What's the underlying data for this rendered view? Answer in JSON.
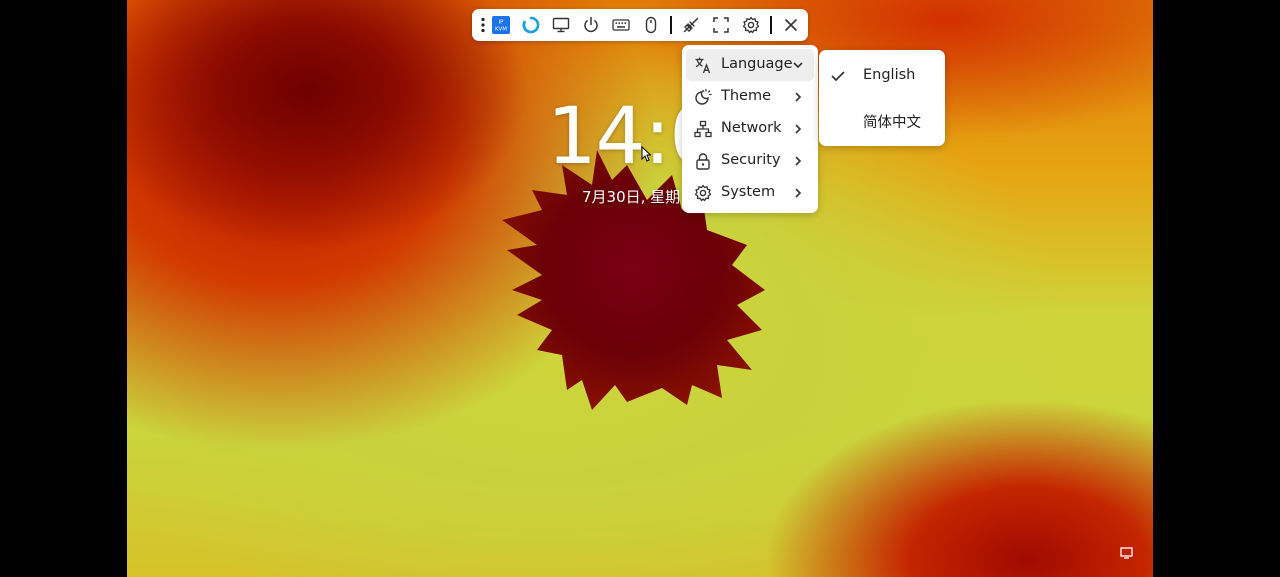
{
  "clock": {
    "time": "14:0",
    "date": "7月30日, 星期"
  },
  "toolbar": {
    "logo_text": "IP KVM",
    "buttons": [
      "more-icon",
      "kvm-logo-icon",
      "refresh-icon",
      "monitor-icon",
      "power-icon",
      "keyboard-icon",
      "mouse-icon",
      "unplug-icon",
      "fullscreen-icon",
      "gear-icon",
      "close-icon"
    ]
  },
  "settings_menu": {
    "items": [
      {
        "label": "Language",
        "icon": "translate-icon",
        "chevron": "down"
      },
      {
        "label": "Theme",
        "icon": "theme-icon",
        "chevron": "right"
      },
      {
        "label": "Network",
        "icon": "network-icon",
        "chevron": "right"
      },
      {
        "label": "Security",
        "icon": "lock-icon",
        "chevron": "right"
      },
      {
        "label": "System",
        "icon": "gear-icon",
        "chevron": "right"
      }
    ]
  },
  "language_menu": {
    "options": [
      {
        "label": "English",
        "selected": true
      },
      {
        "label": "简体中文",
        "selected": false
      }
    ]
  },
  "colors": {
    "accent": "#1a73e8",
    "refresh": "#1ba1e2",
    "menu_bg": "#ffffff",
    "hover_bg": "#eeeeee"
  }
}
